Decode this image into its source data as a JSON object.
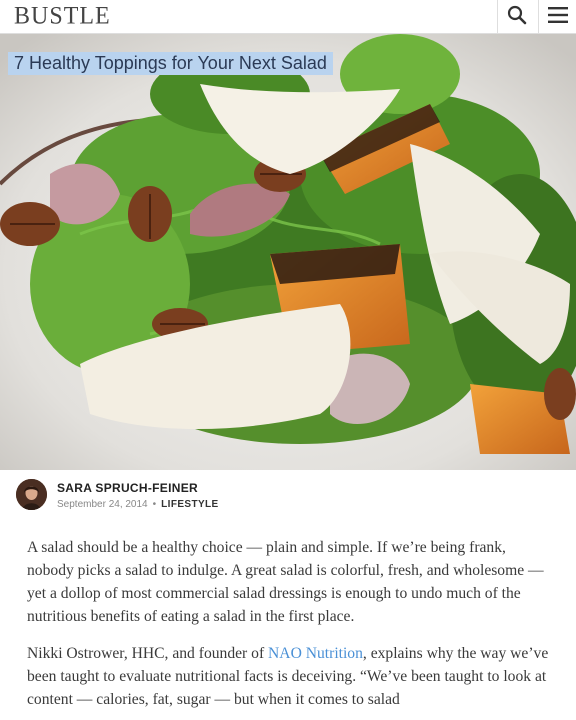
{
  "site": {
    "logo": "BUSTLE",
    "icons": {
      "search": "search-icon",
      "menu": "menu-icon"
    }
  },
  "article": {
    "headline": "7 Healthy Toppings for Your Next Salad",
    "author": "SARA SPRUCH-FEINER",
    "date": "September 24, 2014",
    "separator": "•",
    "category": "LIFESTYLE",
    "paragraph1": "A salad should be a healthy choice — plain and simple. If we’re being frank, nobody picks a salad to indulge. A great salad is colorful, fresh, and wholesome — yet a dollop of most commercial salad dressings is enough to undo much of the nutritious benefits of eating a salad in the first place.",
    "paragraph2": {
      "before_link": "Nikki Ostrower, HHC, and founder of ",
      "link_text": "NAO Nutrition",
      "after_link": ", explains why the way we’ve been taught to evaluate nutritional facts is deceiving. “We’ve been taught to look at content — calories, fat, sugar — but when it comes to salad"
    }
  },
  "colors": {
    "link": "#4a90d6",
    "headline_highlight": "#b9d3ef"
  }
}
